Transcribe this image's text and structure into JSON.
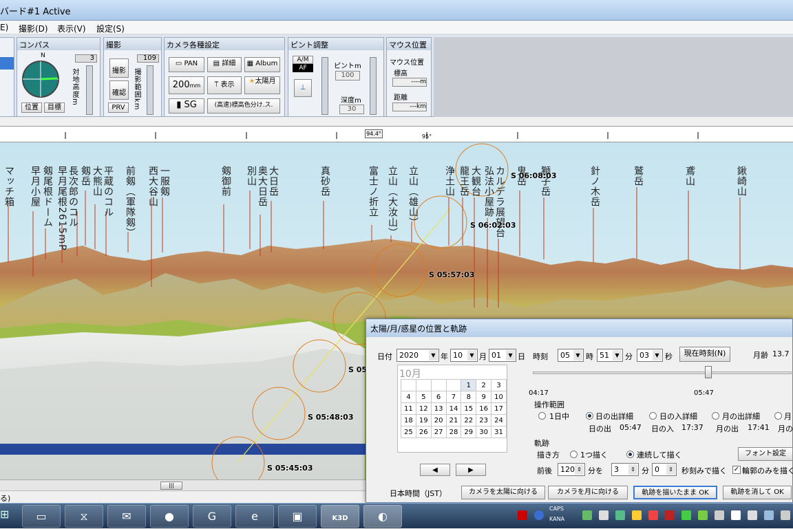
{
  "window": {
    "title": "バード#1 Active"
  },
  "menu": [
    "E)",
    "撮影(D)",
    "表示(V)",
    "設定(S)"
  ],
  "toolbar": {
    "compass": {
      "label": "コンパス",
      "north": "N",
      "height_label": "対地高度m",
      "height_value": "3",
      "btn_position": "位置",
      "btn_target": "目標"
    },
    "shoot": {
      "label": "撮影",
      "btn_shoot": "撮影",
      "btn_confirm": "確認",
      "btn_prv": "PRV",
      "range_label": "撮影範囲km",
      "range_value": "109"
    },
    "camera": {
      "label": "カメラ各種設定",
      "btn_pan": "PAN",
      "btn_detail": "詳細",
      "btn_album": "Album",
      "btn_200": "200",
      "btn_200_unit": "mm",
      "btn_display": "表示",
      "btn_sunmoon": "太陽月",
      "btn_sg": "SG",
      "btn_color": "(高速)標高色分け.ス."
    },
    "focus": {
      "label": "ピント調整",
      "am": "A/M",
      "af": "AF",
      "focus_label": "ピントm",
      "focus_value": "100",
      "depth_label": "深度m",
      "depth_value": "30"
    },
    "mouse": {
      "label": "マウス位置",
      "mouse_label": "マウス位置",
      "elev_label": "標高",
      "elev_value": "----m",
      "dist_label": "距離",
      "dist_value": "---km"
    }
  },
  "ruler": {
    "mark": "94.4°",
    "deg": "95°"
  },
  "peaks": [
    "マッチ箱",
    "早月小屋",
    "剱尾根ドーム",
    "早月尾根2615mP",
    "長次郎のコル",
    "剱岳",
    "大熊山",
    "平蔵のコル",
    "前剱（軍隊剱）",
    "西大谷山",
    "一服剱",
    "剱御前",
    "別山",
    "奥大日岳",
    "大日岳",
    "真砂岳",
    "富士ノ折立",
    "立山（大汝山）",
    "立山（雄山）",
    "浄土山",
    "龍王岳",
    "大観台",
    "弘法小屋跡",
    "カルデラ展望台",
    "鬼岳",
    "獅子岳",
    "針ノ木岳",
    "鷲岳",
    "鳶山",
    "鍬崎山"
  ],
  "sun_labels": [
    "S 06:08:03",
    "S 06:02:03",
    "S 05:57:03",
    "S 05:5",
    "S 05:48:03",
    "S 05:45:03"
  ],
  "status": {
    "text": "る)"
  },
  "dialog": {
    "title": "太陽/月/惑星の位置と軌跡",
    "date_label": "日付",
    "year": "2020",
    "year_unit": "年",
    "month": "10",
    "month_unit": "月",
    "day": "01",
    "day_unit": "日",
    "time_label": "時刻",
    "hour": "05",
    "hour_unit": "時",
    "minute": "51",
    "minute_unit": "分",
    "second": "03",
    "second_unit": "秒",
    "now_button": "現在時刻(N)",
    "moon_age_label": "月齢",
    "moon_age": "13.7",
    "calendar_month": "10月",
    "calendar_rows": [
      [
        "",
        "",
        "",
        "",
        "1",
        "2",
        "3"
      ],
      [
        "4",
        "5",
        "6",
        "7",
        "8",
        "9",
        "10"
      ],
      [
        "11",
        "12",
        "13",
        "14",
        "15",
        "16",
        "17"
      ],
      [
        "18",
        "19",
        "20",
        "21",
        "22",
        "23",
        "24"
      ],
      [
        "25",
        "26",
        "27",
        "28",
        "29",
        "30",
        "31"
      ]
    ],
    "time_start": "04:17",
    "time_current": "05:47",
    "range_label": "操作範囲",
    "range_opts": [
      "1日中",
      "日の出詳細",
      "日の入詳細",
      "月の出詳細",
      "月"
    ],
    "sunrise_label": "日の出",
    "sunrise": "05:47",
    "sunset_label": "日の入",
    "sunset": "17:37",
    "moonrise_label": "月の出",
    "moonrise": "17:41",
    "moonset_label": "月の",
    "track_label": "軌跡",
    "draw_label": "描き方",
    "draw_once": "1つ描く",
    "draw_cont": "連続して描く",
    "font_button": "フォント設定",
    "around_label": "前後",
    "around_value": "120",
    "around_unit": "分を",
    "step_value": "3",
    "step_unit": "分",
    "sec_value": "0",
    "sec_label": "秒刻みで描く",
    "outline_label": "輪郭のみを描く",
    "jst": "日本時間（JST）",
    "btn_to_sun": "カメラを太陽に向ける",
    "btn_to_moon": "カメラを月に向ける",
    "btn_draw_ok": "軌跡を描いたまま OK",
    "btn_erase_ok": "軌跡を消して OK"
  },
  "taskbar": {
    "k3d": "K3D",
    "caps": "CAPS",
    "kana": "KANA"
  },
  "colors": {
    "accent": "#1f3552",
    "sky_top": "#c6e4ef",
    "sun_circle": "#e07a1a"
  }
}
